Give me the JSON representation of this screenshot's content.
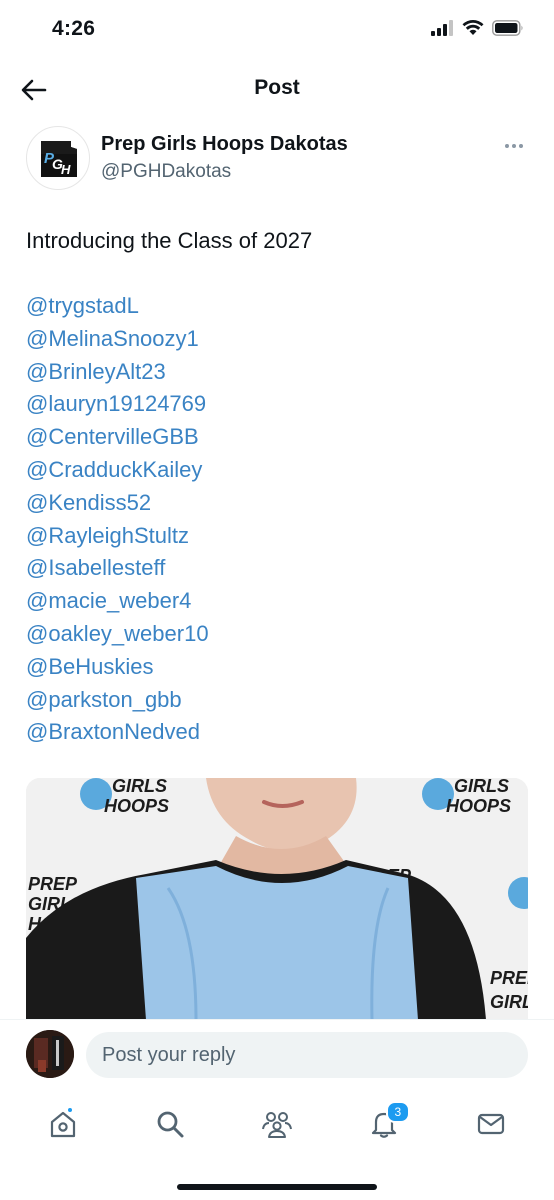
{
  "status_bar": {
    "time": "4:26"
  },
  "header": {
    "title": "Post"
  },
  "author": {
    "name": "Prep Girls Hoops Dakotas",
    "handle": "@PGHDakotas",
    "logo_text": "PGH"
  },
  "post": {
    "text": "Introducing the Class of 2027",
    "mentions": [
      "@trygstadL",
      "@MelinaSnoozy1",
      "@BrinleyAlt23",
      "@lauryn19124769",
      "@CentervilleGBB",
      "@CradduckKailey",
      "@Kendiss52",
      "@RayleighStultz",
      "@Isabellesteff",
      "@macie_weber4",
      "@oakley_weber10",
      "@BeHuskies",
      "@parkston_gbb",
      "@BraxtonNedved"
    ],
    "image_backdrop_text": [
      "GIRLS",
      "HOOPS",
      "PREP",
      "GIRLS",
      "HOOPS",
      "PREP",
      "GIRLS",
      "HOOPS",
      "PREP",
      "GIRLS"
    ]
  },
  "reply": {
    "placeholder": "Post your reply"
  },
  "nav": {
    "items": [
      {
        "name": "home",
        "icon": "home-icon"
      },
      {
        "name": "search",
        "icon": "search-icon"
      },
      {
        "name": "communities",
        "icon": "people-icon"
      },
      {
        "name": "notifications",
        "icon": "bell-icon",
        "badge": "3"
      },
      {
        "name": "messages",
        "icon": "mail-icon"
      }
    ]
  },
  "colors": {
    "link": "#3a83c4",
    "accent": "#1d9bf0",
    "jersey": "#9cc5e8"
  }
}
